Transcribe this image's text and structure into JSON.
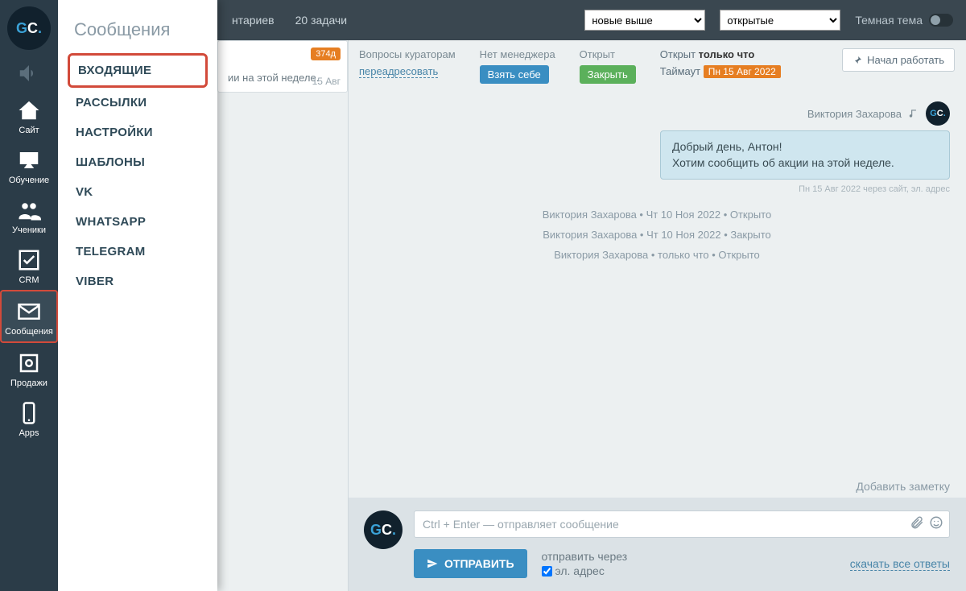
{
  "rail": {
    "logo": "GC.",
    "items": [
      {
        "key": "sound",
        "label": "",
        "icon": "sound"
      },
      {
        "key": "site",
        "label": "Сайт",
        "icon": "home"
      },
      {
        "key": "learning",
        "label": "Обучение",
        "icon": "board"
      },
      {
        "key": "students",
        "label": "Ученики",
        "icon": "people"
      },
      {
        "key": "crm",
        "label": "CRM",
        "icon": "check"
      },
      {
        "key": "messages",
        "label": "Сообщения",
        "icon": "mail",
        "active": true
      },
      {
        "key": "sales",
        "label": "Продажи",
        "icon": "safe"
      },
      {
        "key": "apps",
        "label": "Apps",
        "icon": "phone"
      }
    ]
  },
  "submenu": {
    "title": "Сообщения",
    "items": [
      {
        "label": "ВХОДЯЩИЕ",
        "highlight": true
      },
      {
        "label": "РАССЫЛКИ"
      },
      {
        "label": "НАСТРОЙКИ"
      },
      {
        "label": "ШАБЛОНЫ"
      },
      {
        "label": "VK"
      },
      {
        "label": "WHATSAPP"
      },
      {
        "label": "TELEGRAM"
      },
      {
        "label": "VIBER"
      }
    ]
  },
  "topbar": {
    "left": [
      "нтариев",
      "20 задачи"
    ],
    "sort_options": [
      "новые выше"
    ],
    "filter_options": [
      "открытые"
    ],
    "theme_label": "Темная тема"
  },
  "listcard": {
    "badge": "374д",
    "text": "ии на этой неделе.",
    "date": "15 Авг"
  },
  "conv": {
    "head": {
      "g1_label": "Вопросы кураторам",
      "g1_action": "переадресовать",
      "g2_label": "Нет менеджера",
      "g2_action": "Взять себе",
      "g3_label": "Открыт",
      "g3_action": "Закрыть",
      "g4_line": "Открыт ",
      "g4_bold": "только что",
      "g4_sub_pre": "Таймаут ",
      "g4_sub_tag": "Пн 15 Авг 2022",
      "start_btn": "Начал работать"
    },
    "sender": "Виктория Захарова",
    "bubble_line1": "Добрый день, Антон!",
    "bubble_line2": "Хотим сообщить об акции на этой неделе.",
    "bubble_meta": "Пн 15 Авг 2022 через сайт, эл. адрес",
    "logs": [
      "Виктория Захарова • Чт 10 Ноя 2022 • Открыто",
      "Виктория Захарова • Чт 10 Ноя 2022 • Закрыто",
      "Виктория Захарова • только что • Открыто"
    ],
    "add_note": "Добавить заметку",
    "composer": {
      "placeholder": "Ctrl + Enter — отправляет сообщение",
      "send": "ОТПРАВИТЬ",
      "via_label": "отправить через",
      "via_opt": "эл. адрес",
      "download": "скачать все ответы"
    }
  }
}
